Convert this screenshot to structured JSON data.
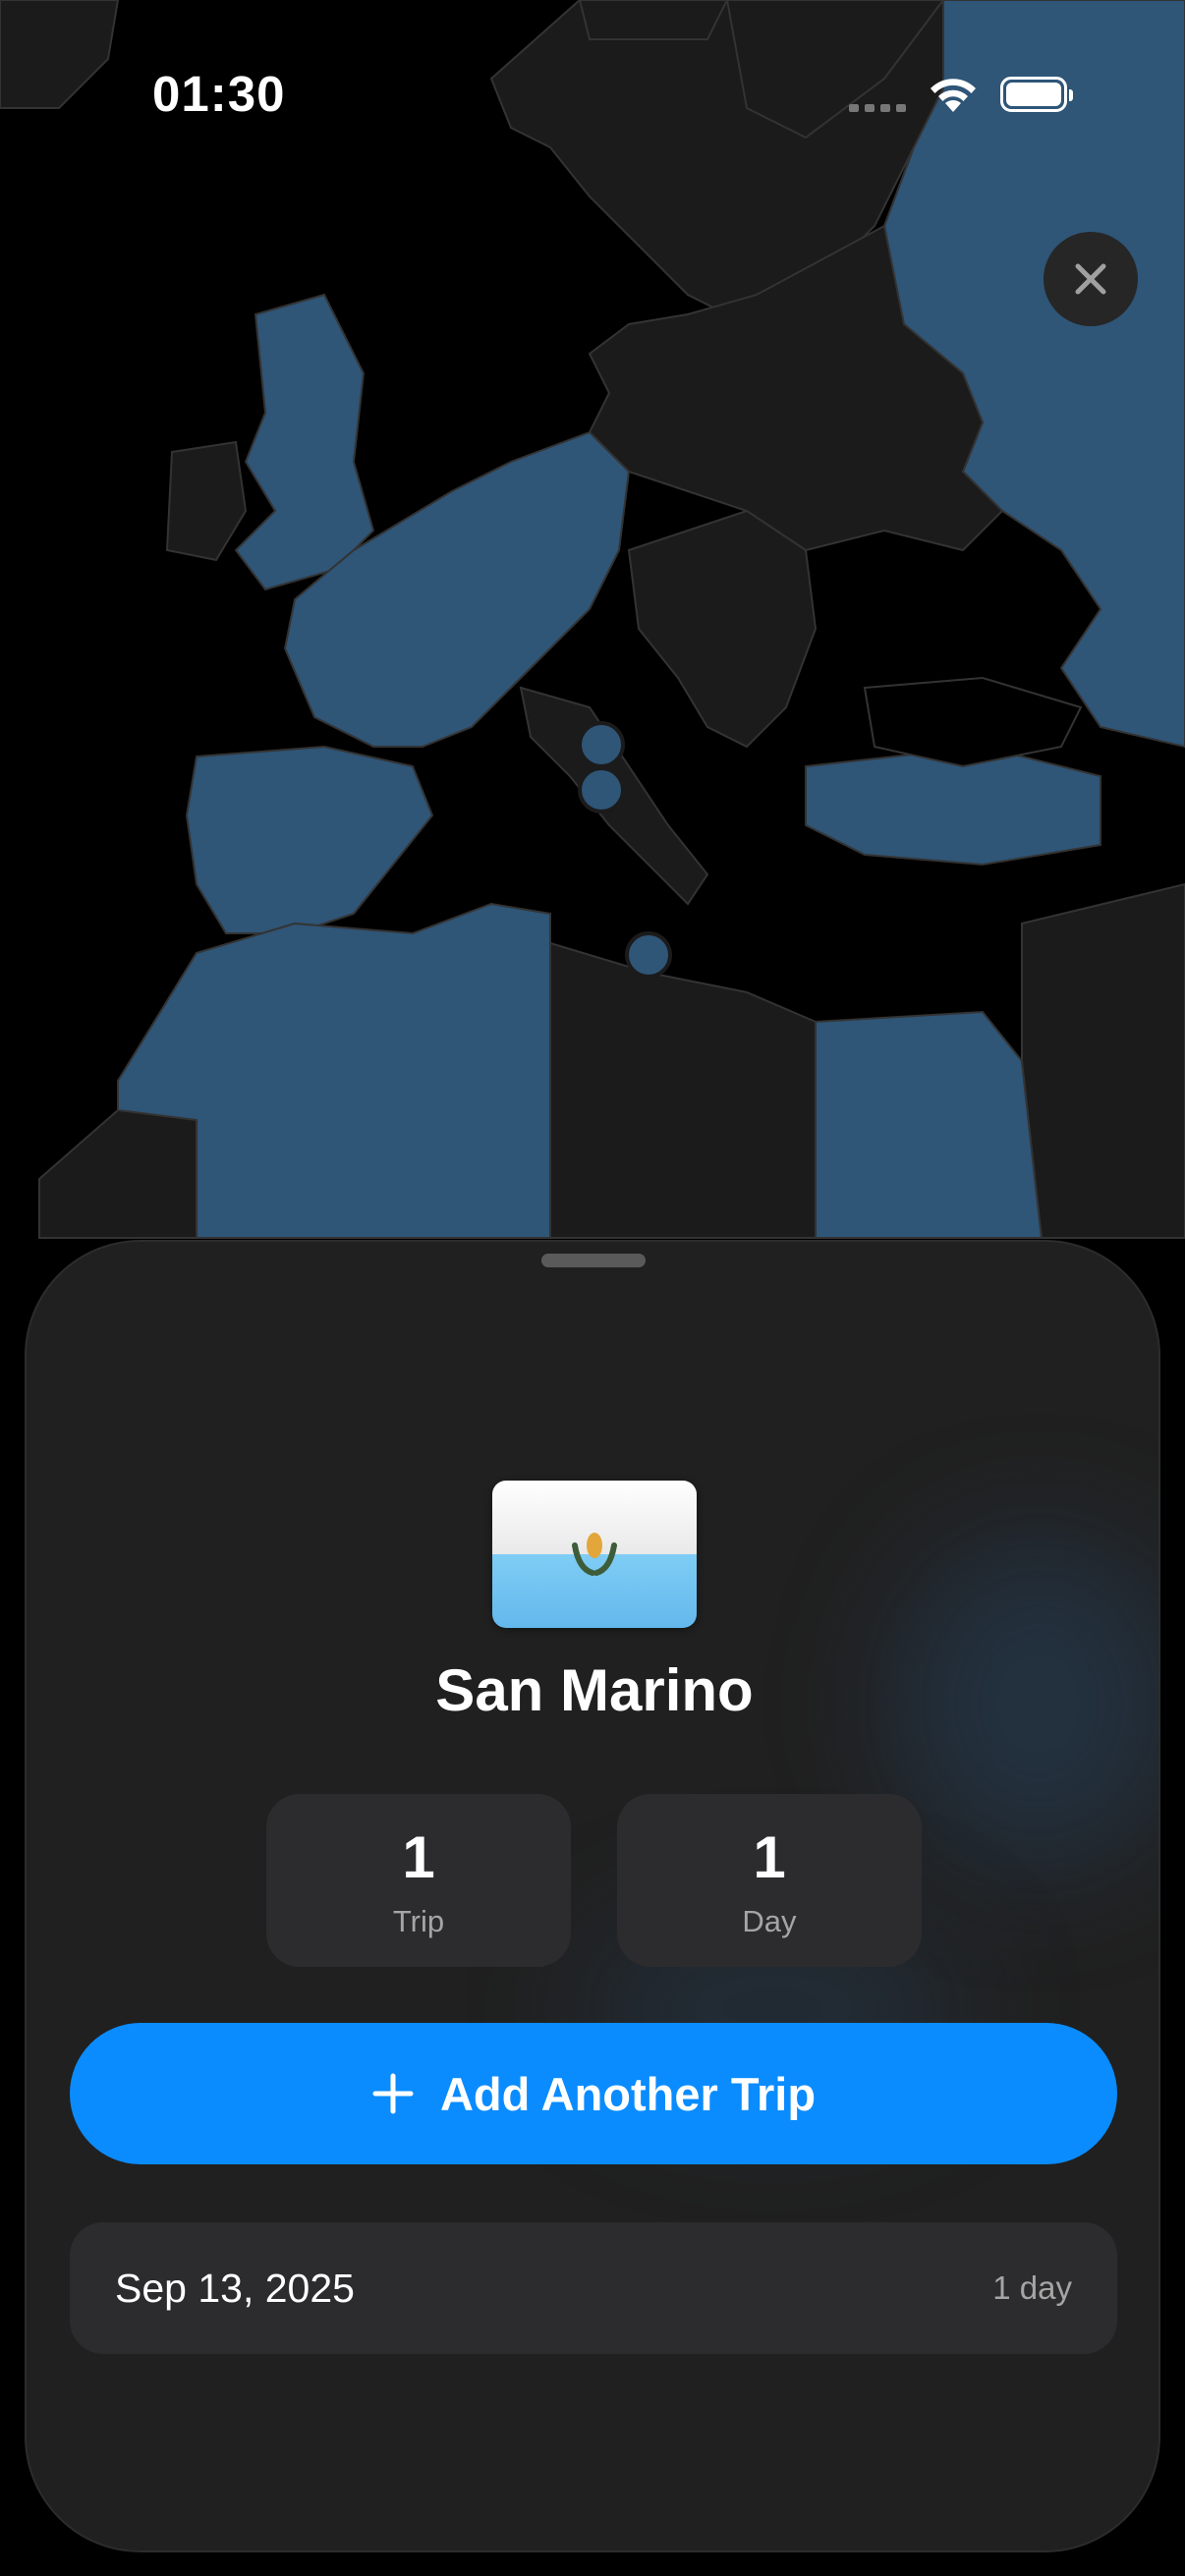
{
  "status_bar": {
    "time": "01:30",
    "icons": [
      "cellular-signal-icon",
      "wifi-icon",
      "battery-icon"
    ]
  },
  "map": {
    "land_color": "#1b1b1b",
    "highlighted_color": "#2f5577",
    "water_color": "#000000"
  },
  "close_button": {
    "icon": "close-icon"
  },
  "sheet": {
    "country": "San Marino",
    "flag_icon": "san-marino-flag-icon",
    "stats": [
      {
        "value": "1",
        "label": "Trip"
      },
      {
        "value": "1",
        "label": "Day"
      }
    ],
    "add_button": {
      "icon": "plus-icon",
      "label": "Add Another Trip",
      "color": "#0a8cff"
    },
    "trips": [
      {
        "date": "Sep 13, 2025",
        "duration": "1 day"
      }
    ]
  }
}
